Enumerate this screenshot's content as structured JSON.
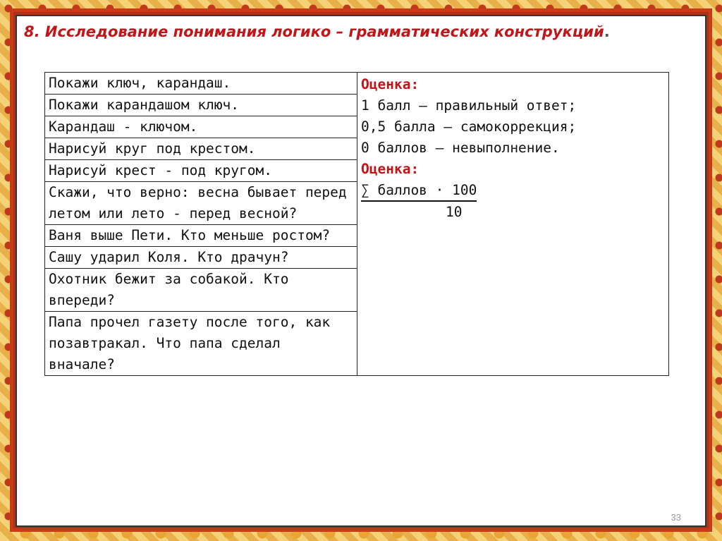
{
  "slide": {
    "title": "8. Исследование понимания логико – грамматических конструкций",
    "title_dot": ".",
    "page_number": "33"
  },
  "tasks": [
    "Покажи ключ, карандаш.",
    "Покажи карандашом ключ.",
    "Карандаш - ключом.",
    "Нарисуй круг под крестом.",
    "Нарисуй крест - под кругом.",
    "Скажи, что верно: весна бывает перед летом или лето - перед весной?",
    "Ваня выше Пети. Кто меньше ростом?",
    "Сашу ударил Коля. Кто драчун?",
    "Охотник бежит за собакой. Кто впереди?",
    "Папа прочел газету после того, как позавтракал. Что папа сделал вначале?"
  ],
  "scoring": {
    "label1": "Оценка:",
    "line1": "1 балл – правильный ответ;",
    "line2": "0,5 балла – самокоррекция;",
    "line3": "0 баллов – невыполнение.",
    "label2": "Оценка:",
    "formula_numerator": "∑ баллов · 100",
    "formula_denominator": "10"
  },
  "colors": {
    "title": "#c0161a",
    "label": "#c0161a",
    "frame_red": "#c83a18",
    "frame_gold": "#f2c15a"
  }
}
